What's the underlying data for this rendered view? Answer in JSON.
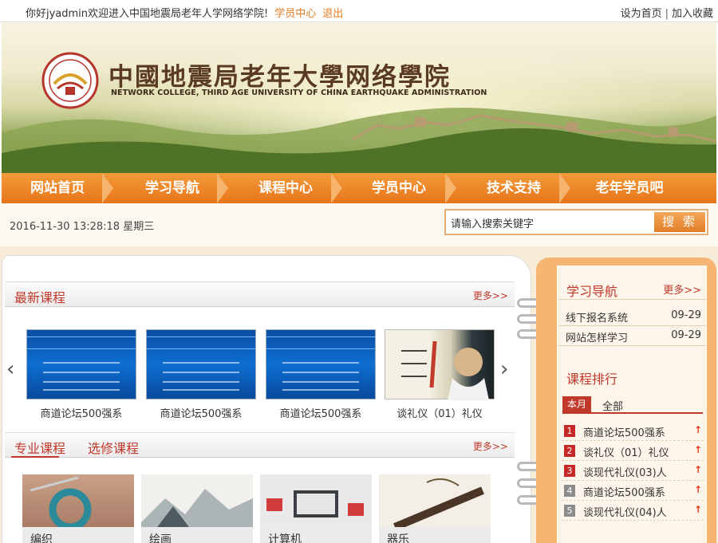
{
  "topbar": {
    "greeting": "你好jyadmin欢迎进入中国地震局老年人学网络学院!",
    "student_center": "学员中心",
    "logout": "退出",
    "set_home": "设为首页",
    "separator": "|",
    "bookmark": "加入收藏"
  },
  "banner": {
    "title_cn": "中國地震局老年大學网络學院",
    "title_en": "NETWORK COLLEGE, THIRD AGE UNIVERSITY OF CHINA EARTHQUAKE ADMINISTRATION"
  },
  "nav": {
    "items": [
      "网站首页",
      "学习导航",
      "课程中心",
      "学员中心",
      "技术支持",
      "老年学员吧"
    ]
  },
  "infobar": {
    "datetime": "2016-11-30 13:28:18 星期三",
    "search_value": "请输入搜索关键字",
    "search_button": "搜 索"
  },
  "latest": {
    "title": "最新课程",
    "more": "更多>>",
    "prev_icon": "‹",
    "next_icon": "›",
    "courses": [
      "商道论坛500强系",
      "商道论坛500强系",
      "商道论坛500强系",
      "谈礼仪（01）礼仪"
    ]
  },
  "categories": {
    "tab_major": "专业课程",
    "tab_elective": "选修课程",
    "more": "更多>>",
    "items": [
      "编织",
      "绘画",
      "计算机",
      "器乐"
    ]
  },
  "study_nav": {
    "title": "学习导航",
    "more": "更多>>",
    "items": [
      {
        "label": "线下报名系统",
        "date": "09-29"
      },
      {
        "label": "网站怎样学习",
        "date": "09-29"
      }
    ]
  },
  "ranking": {
    "title": "课程排行",
    "tab_month": "本月",
    "tab_all": "全部",
    "items": [
      {
        "num": "1",
        "label": "商道论坛500强系",
        "color": "#c62828"
      },
      {
        "num": "2",
        "label": "谈礼仪（01）礼仪",
        "color": "#c62828"
      },
      {
        "num": "3",
        "label": "谈现代礼仪(03)人",
        "color": "#c62828"
      },
      {
        "num": "4",
        "label": "商道论坛500强系",
        "color": "#8c8c8c"
      },
      {
        "num": "5",
        "label": "谈现代礼仪(04)人",
        "color": "#8c8c8c"
      }
    ],
    "up_icon": "↑"
  }
}
